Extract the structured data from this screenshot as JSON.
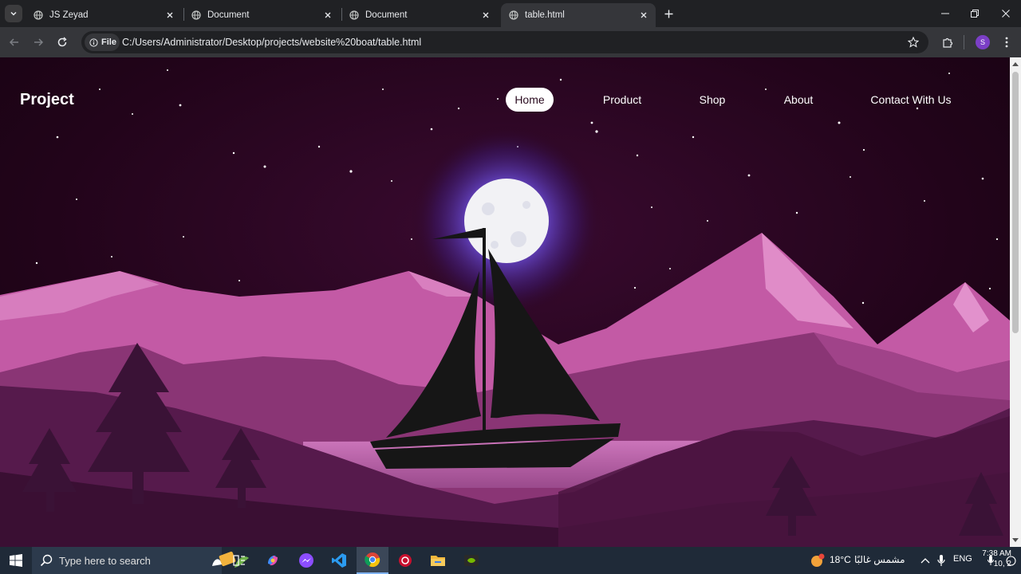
{
  "browser": {
    "tabs": [
      {
        "title": "JS Zeyad"
      },
      {
        "title": "Document"
      },
      {
        "title": "Document"
      },
      {
        "title": "table.html",
        "active": true
      }
    ],
    "site_chip_label": "File",
    "url": "C:/Users/Administrator/Desktop/projects/website%20boat/table.html",
    "profile_initial": "S"
  },
  "page": {
    "logo": "Project",
    "nav": [
      {
        "label": "Home",
        "active": true
      },
      {
        "label": "Product"
      },
      {
        "label": "Shop"
      },
      {
        "label": "About"
      },
      {
        "label": "Contact With Us"
      }
    ]
  },
  "taskbar": {
    "search_placeholder": "Type here to search",
    "weather_temp": "18°C",
    "weather_desc": "مشمس غالبًا",
    "language": "ENG",
    "time": "7:38 AM",
    "date": "10, 2"
  },
  "colors": {
    "sky": "#1b0312",
    "mountain_light": "#c45aa6",
    "mountain_mid": "#8a3575",
    "mountain_dark": "#4a1440",
    "water": "#c86fb5",
    "boat": "#161616",
    "moon": "#f2f2f5"
  },
  "icons": {
    "tab_favicon": "globe-icon",
    "site_chip": "info-icon",
    "bookmark": "star-icon",
    "extensions": "puzzle-icon",
    "menu": "kebab-menu-icon"
  }
}
